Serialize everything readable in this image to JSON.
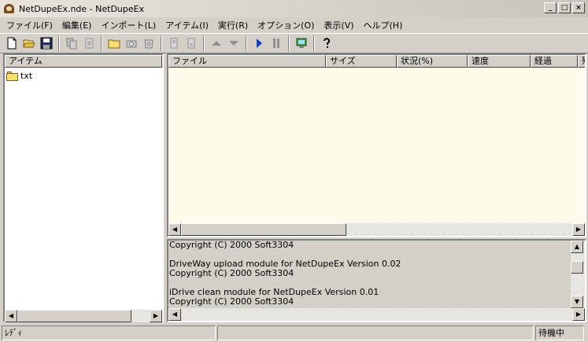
{
  "window": {
    "title": "NetDupeEx.nde - NetDupeEx"
  },
  "title_buttons": {
    "minimize": "_",
    "maximize": "□",
    "close": "×"
  },
  "menu": [
    "ファイル(F)",
    "編集(E)",
    "インポート(L)",
    "アイテム(I)",
    "実行(R)",
    "オプション(O)",
    "表示(V)",
    "ヘルプ(H)"
  ],
  "toolbar_icons": [
    "new-icon",
    "open-icon",
    "save-icon",
    "copy-icon",
    "paste-icon",
    "folder-icon",
    "camera-icon",
    "recycle-icon",
    "page-up-icon",
    "page-down-icon",
    "arrow-up-icon",
    "arrow-down-icon",
    "play-icon",
    "pause-icon",
    "network-icon",
    "help-icon"
  ],
  "tree": {
    "header": "アイテム",
    "items": [
      {
        "label": "txt",
        "icon": "folder-icon"
      }
    ]
  },
  "file_list": {
    "columns": [
      "ファイル",
      "サイズ",
      "状況(%)",
      "速度",
      "経過",
      "残"
    ]
  },
  "log": {
    "lines": [
      "Copyright (C) 2000 Soft3304",
      "",
      "DriveWay upload module for NetDupeEx Version 0.02",
      "Copyright (C) 2000 Soft3304",
      "",
      "iDrive clean module for NetDupeEx Version 0.01",
      "Copyright (C) 2000 Soft3304"
    ]
  },
  "status": {
    "left": "ﾚﾃﾞｨ",
    "middle": "",
    "right": "待機中"
  },
  "colors": {
    "face": "#d4d0c8",
    "list_bg": "#fefbea",
    "play": "#1a3fc0"
  }
}
